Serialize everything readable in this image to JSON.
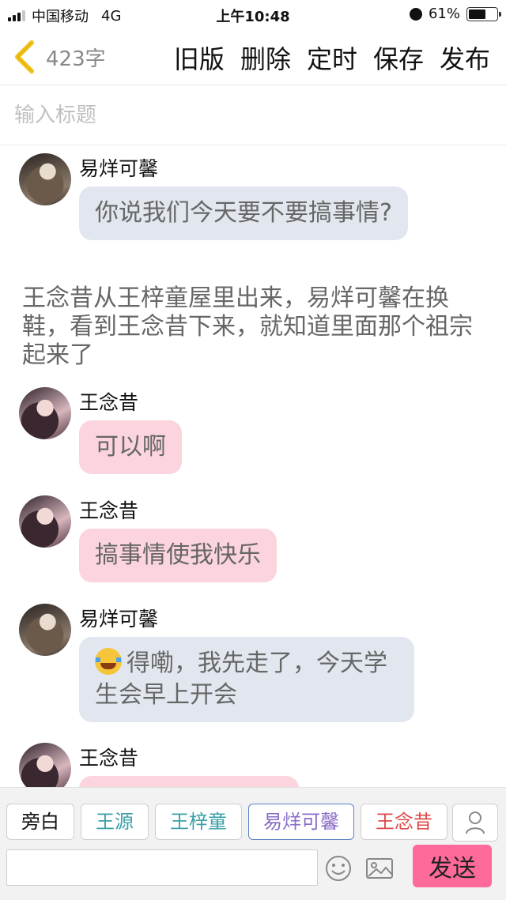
{
  "status_bar": {
    "carrier": "中国移动",
    "network": "4G",
    "time": "上午10:48",
    "battery_percent": "61%",
    "battery_level": 0.61
  },
  "nav": {
    "word_count": "423字",
    "actions": [
      "旧版",
      "删除",
      "定时",
      "保存",
      "发布"
    ]
  },
  "title_input": {
    "placeholder": "输入标题",
    "value": ""
  },
  "messages": [
    {
      "type": "chat",
      "sender": "易烊可馨",
      "style": "blue",
      "text": "你说我们今天要不要搞事情?"
    },
    {
      "type": "narration",
      "text": "王念昔从王梓童屋里出来，易烊可馨在换鞋，看到王念昔下来，就知道里面那个祖宗起来了"
    },
    {
      "type": "chat",
      "sender": "王念昔",
      "style": "pink",
      "text": "可以啊"
    },
    {
      "type": "chat",
      "sender": "王念昔",
      "style": "pink",
      "text": "搞事情使我快乐"
    },
    {
      "type": "chat",
      "sender": "易烊可馨",
      "style": "blue",
      "emoji": "laughing-tears-emoji",
      "text": "得嘞，我先走了，今天学生会早上开会"
    },
    {
      "type": "chat",
      "sender": "王念昔",
      "style": "pink",
      "text": ""
    }
  ],
  "roles": [
    {
      "label": "旁白",
      "color": "#111111"
    },
    {
      "label": "王源",
      "color": "#3aa0a8"
    },
    {
      "label": "王梓童",
      "color": "#3aa0a8"
    },
    {
      "label": "易烊可馨",
      "color": "#8a6cc7"
    },
    {
      "label": "王念昔",
      "color": "#e04a4a"
    }
  ],
  "composer": {
    "placeholder": "",
    "send_label": "发送"
  },
  "colors": {
    "accent_pink": "#fe6a9a",
    "bubble_blue": "#e2e7ef",
    "bubble_pink": "#fbd4dd",
    "back_arrow": "#f2c21a"
  }
}
